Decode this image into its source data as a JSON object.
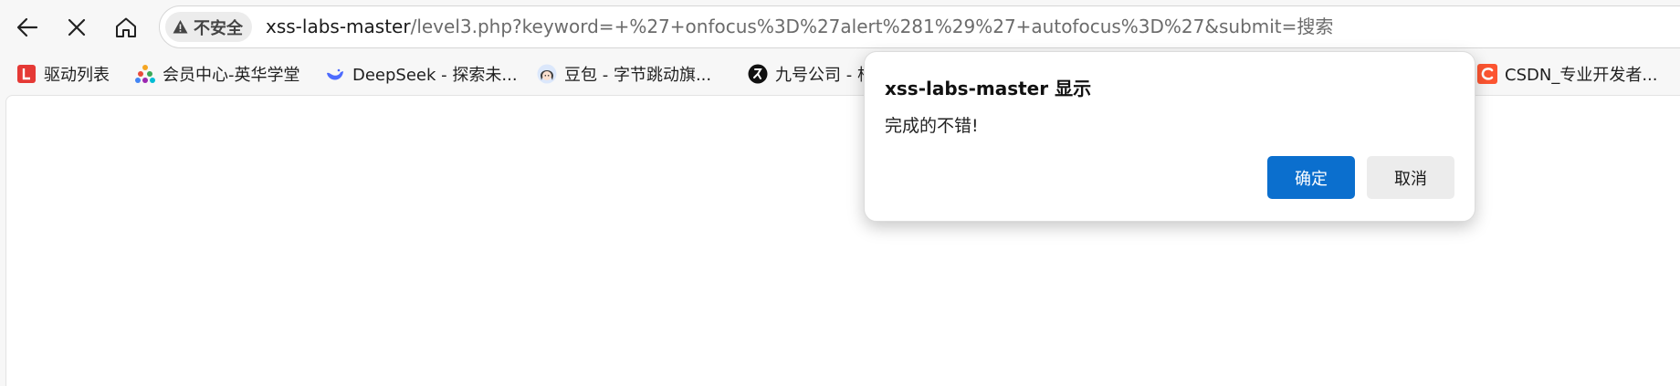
{
  "toolbar": {
    "back_icon": "arrow-left-icon",
    "stop_icon": "close-icon",
    "home_icon": "home-icon"
  },
  "address_bar": {
    "security_icon": "warning-triangle-icon",
    "security_label": "不安全",
    "host": "xss-labs-master",
    "path": "/level3.php?keyword=+%27+onfocus%3D%27alert%281%29%27+autofocus%3D%27&submit=搜索"
  },
  "bookmarks": [
    {
      "label": "驱动列表",
      "icon": "red-square-L-icon",
      "color": "#e53935"
    },
    {
      "label": "会员中心-英华学堂",
      "icon": "colorful-triangle-logo-icon",
      "color": "#f5a623"
    },
    {
      "label": "DeepSeek - 探索未...",
      "icon": "whale-logo-icon",
      "color": "#4d6bfe"
    },
    {
      "label": "豆包 - 字节跳动旗...",
      "icon": "avatar-girl-icon",
      "color": "#8ab4f8"
    },
    {
      "label": "九号公司 - 根",
      "icon": "runner-logo-icon",
      "color": "#111111"
    },
    {
      "label": "CSDN_专业开发者...",
      "icon": "csdn-c-logo-icon",
      "color": "#fc5531"
    }
  ],
  "dialog": {
    "title": "xss-labs-master 显示",
    "message": "完成的不错!",
    "ok_label": "确定",
    "cancel_label": "取消",
    "ok_color": "#0b6fce"
  }
}
